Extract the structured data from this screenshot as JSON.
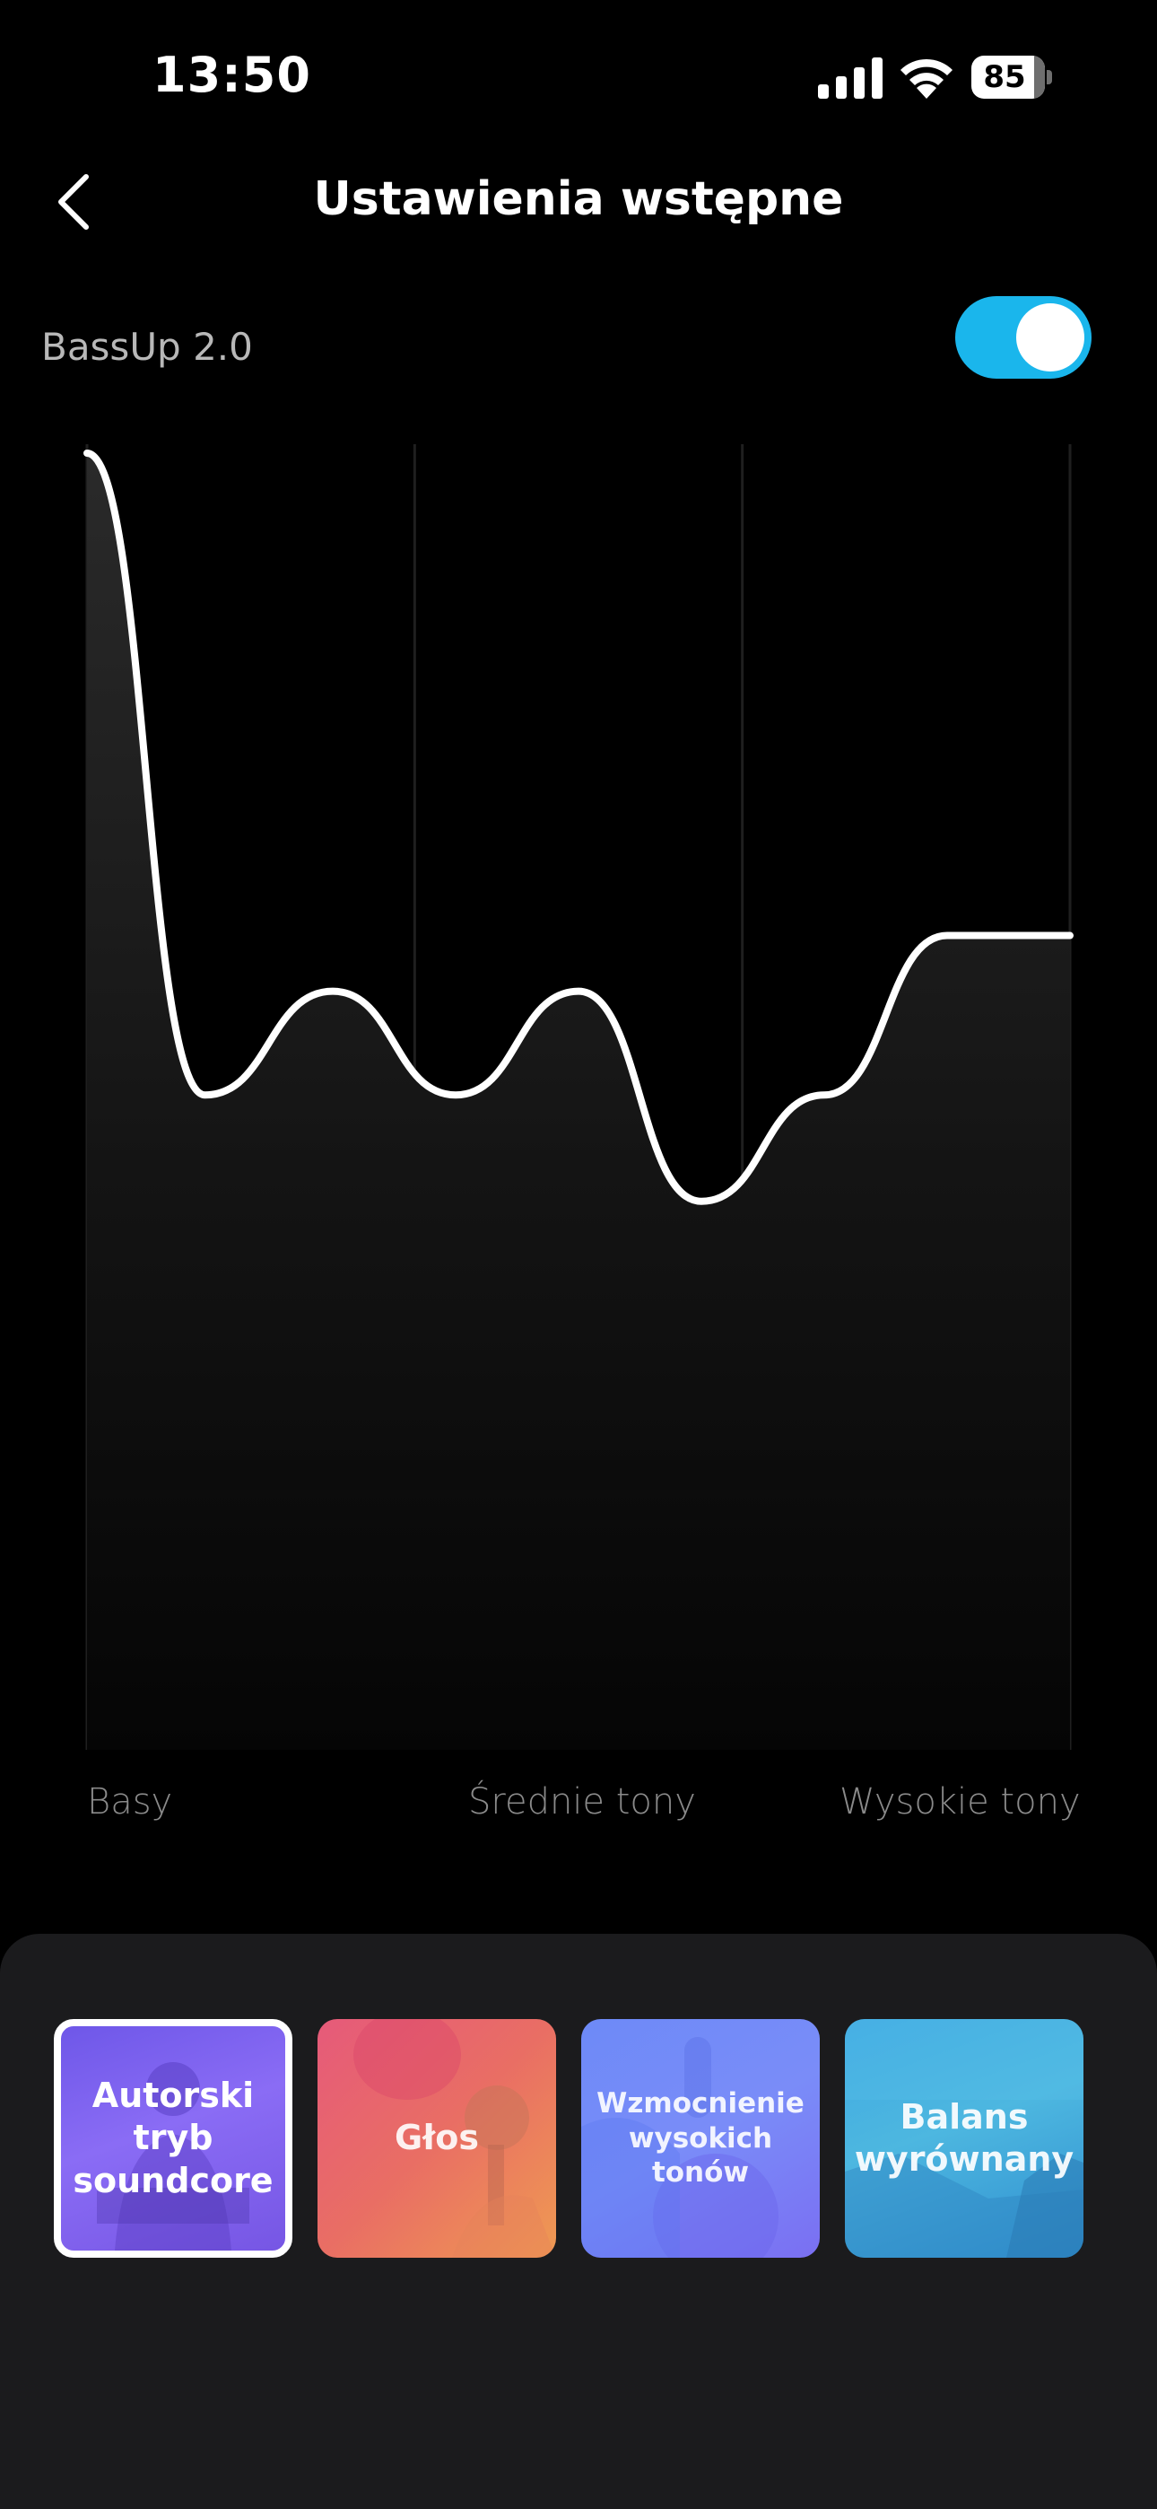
{
  "status_bar": {
    "time": "13:50",
    "battery_level": "85",
    "icons": [
      "signal-icon",
      "wifi-icon",
      "battery-icon"
    ]
  },
  "header": {
    "title": "Ustawienia wstępne",
    "back_icon": "chevron-left-icon"
  },
  "bassup": {
    "label": "BassUp 2.0",
    "enabled": true,
    "accent_color": "#1ab6ec"
  },
  "eq": {
    "band_labels": [
      "Basy",
      "Średnie tony",
      "Wysokie tony"
    ],
    "curve": [
      {
        "x": 0.0,
        "level": 1.0
      },
      {
        "x": 0.12,
        "level": 0.505
      },
      {
        "x": 0.25,
        "level": 0.585
      },
      {
        "x": 0.375,
        "level": 0.505
      },
      {
        "x": 0.5,
        "level": 0.585
      },
      {
        "x": 0.625,
        "level": 0.423
      },
      {
        "x": 0.75,
        "level": 0.505
      },
      {
        "x": 0.875,
        "level": 0.628
      },
      {
        "x": 1.0,
        "level": 0.628
      }
    ],
    "line_color": "#ffffff"
  },
  "presets": [
    {
      "label_lines": [
        "Autorski tryb",
        "soundcore"
      ],
      "selected": true,
      "image": "person-headphones-photo"
    },
    {
      "label_lines": [
        "Głos"
      ],
      "selected": false,
      "image": "singer-microphone-photo"
    },
    {
      "label_lines": [
        "Wzmocnienie",
        "wysokich tonów"
      ],
      "selected": false,
      "image": "microphone-photo"
    },
    {
      "label_lines": [
        "Balans",
        "wyrównany"
      ],
      "selected": false,
      "image": "ocean-cliff-photo"
    }
  ]
}
